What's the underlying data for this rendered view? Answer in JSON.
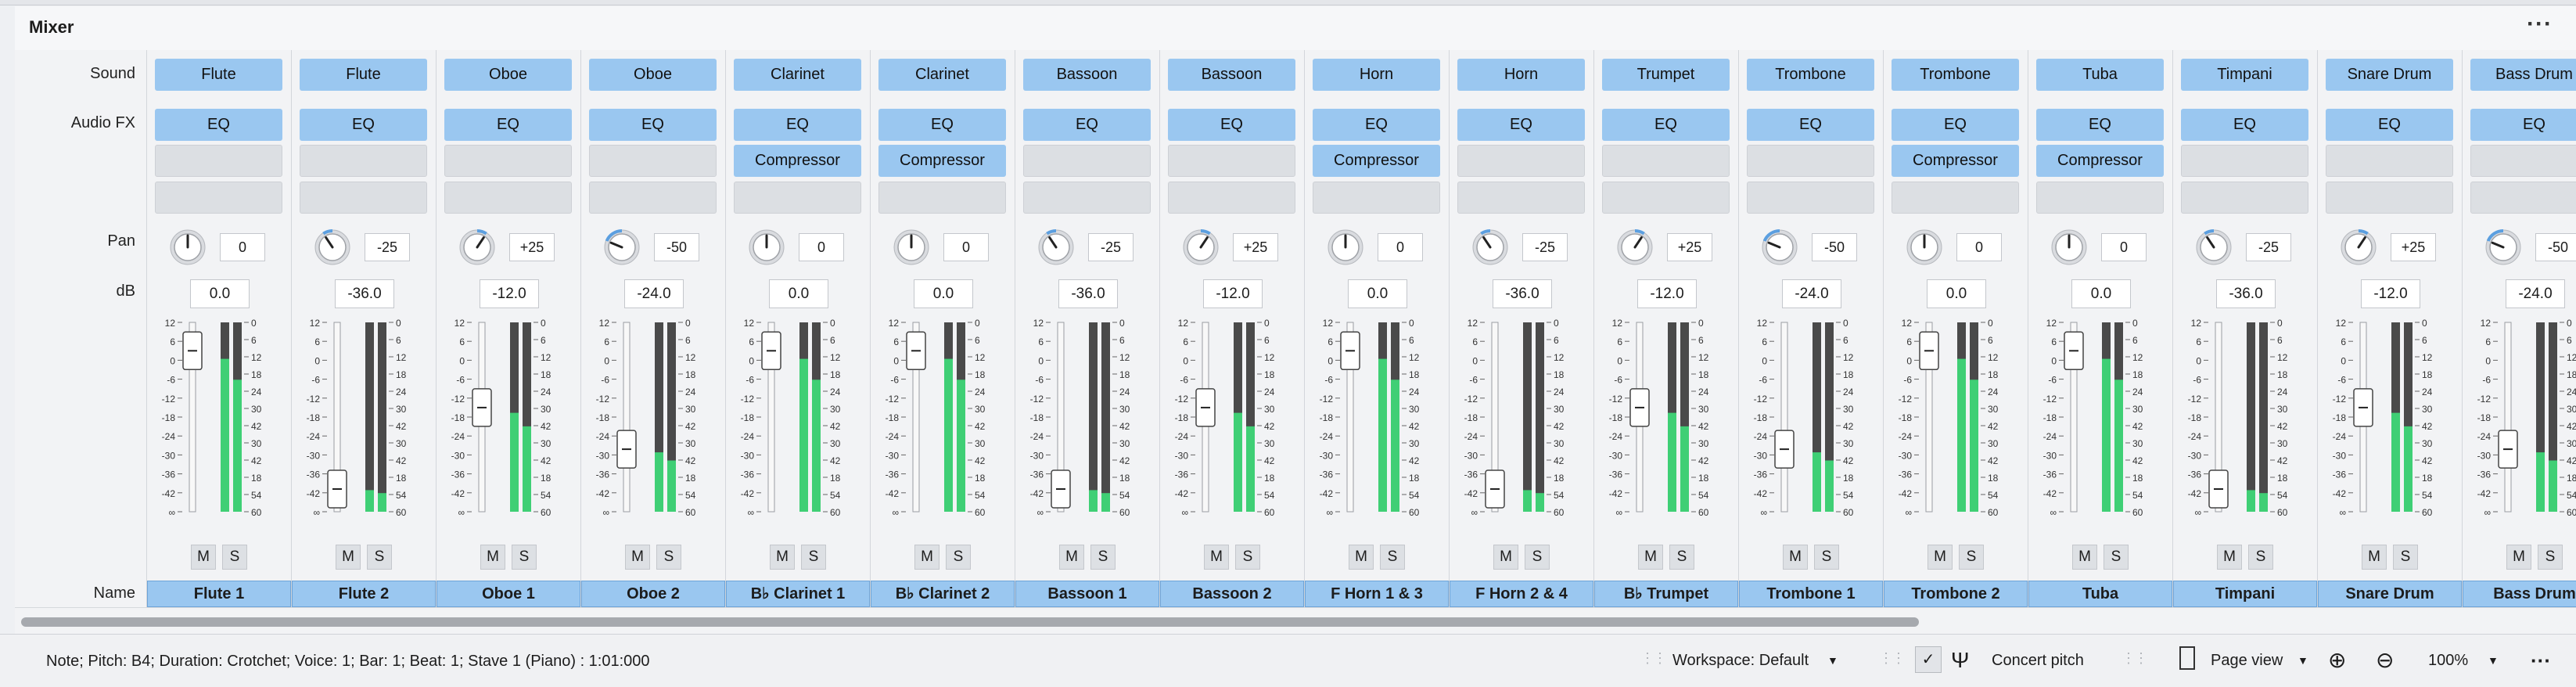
{
  "window_title": "Mixer",
  "menu_glyph": "···",
  "row_labels": {
    "sound": "Sound",
    "audio_fx": "Audio FX",
    "pan": "Pan",
    "db": "dB",
    "name": "Name"
  },
  "mute_label": "M",
  "solo_label": "S",
  "meter_scale_left": [
    "12",
    "6",
    "0",
    "-6",
    "-12",
    "-18",
    "-24",
    "-30",
    "-36",
    "-42",
    "∞"
  ],
  "meter_scale_right": [
    "0",
    "6",
    "12",
    "18",
    "24",
    "30",
    "42",
    "30",
    "42",
    "18",
    "54",
    "60"
  ],
  "channels": [
    {
      "sound": "Flute",
      "fx": [
        "EQ",
        ""
      ],
      "pan": "0",
      "pan_value": 0,
      "db": "0.0",
      "level": 0.85,
      "name": "Flute 1"
    },
    {
      "sound": "Flute",
      "fx": [
        "EQ",
        ""
      ],
      "pan": "-25",
      "pan_value": -25,
      "db": "-36.0",
      "level": 0.12,
      "name": "Flute 2"
    },
    {
      "sound": "Oboe",
      "fx": [
        "EQ",
        ""
      ],
      "pan": "+25",
      "pan_value": 25,
      "db": "-12.0",
      "level": 0.55,
      "name": "Oboe 1"
    },
    {
      "sound": "Oboe",
      "fx": [
        "EQ",
        ""
      ],
      "pan": "-50",
      "pan_value": -50,
      "db": "-24.0",
      "level": 0.33,
      "name": "Oboe 2"
    },
    {
      "sound": "Clarinet",
      "fx": [
        "EQ",
        "Compressor"
      ],
      "pan": "0",
      "pan_value": 0,
      "db": "0.0",
      "level": 0.85,
      "name": "B♭ Clarinet 1"
    },
    {
      "sound": "Clarinet",
      "fx": [
        "EQ",
        "Compressor"
      ],
      "pan": "0",
      "pan_value": 0,
      "db": "0.0",
      "level": 0.85,
      "name": "B♭ Clarinet 2"
    },
    {
      "sound": "Bassoon",
      "fx": [
        "EQ",
        ""
      ],
      "pan": "-25",
      "pan_value": -25,
      "db": "-36.0",
      "level": 0.12,
      "name": "Bassoon 1"
    },
    {
      "sound": "Bassoon",
      "fx": [
        "EQ",
        ""
      ],
      "pan": "+25",
      "pan_value": 25,
      "db": "-12.0",
      "level": 0.55,
      "name": "Bassoon 2"
    },
    {
      "sound": "Horn",
      "fx": [
        "EQ",
        "Compressor"
      ],
      "pan": "0",
      "pan_value": 0,
      "db": "0.0",
      "level": 0.85,
      "name": "F Horn 1 & 3"
    },
    {
      "sound": "Horn",
      "fx": [
        "EQ",
        ""
      ],
      "pan": "-25",
      "pan_value": -25,
      "db": "-36.0",
      "level": 0.12,
      "name": "F Horn 2 & 4"
    },
    {
      "sound": "Trumpet",
      "fx": [
        "EQ",
        ""
      ],
      "pan": "+25",
      "pan_value": 25,
      "db": "-12.0",
      "level": 0.55,
      "name": "B♭ Trumpet"
    },
    {
      "sound": "Trombone",
      "fx": [
        "EQ",
        ""
      ],
      "pan": "-50",
      "pan_value": -50,
      "db": "-24.0",
      "level": 0.33,
      "name": "Trombone 1"
    },
    {
      "sound": "Trombone",
      "fx": [
        "EQ",
        "Compressor"
      ],
      "pan": "0",
      "pan_value": 0,
      "db": "0.0",
      "level": 0.85,
      "name": "Trombone 2"
    },
    {
      "sound": "Tuba",
      "fx": [
        "EQ",
        "Compressor"
      ],
      "pan": "0",
      "pan_value": 0,
      "db": "0.0",
      "level": 0.85,
      "name": "Tuba"
    },
    {
      "sound": "Timpani",
      "fx": [
        "EQ",
        ""
      ],
      "pan": "-25",
      "pan_value": -25,
      "db": "-36.0",
      "level": 0.12,
      "name": "Timpani"
    },
    {
      "sound": "Snare Drum",
      "fx": [
        "EQ",
        ""
      ],
      "pan": "+25",
      "pan_value": 25,
      "db": "-12.0",
      "level": 0.55,
      "name": "Snare Drum"
    },
    {
      "sound": "Bass Drum",
      "fx": [
        "EQ",
        ""
      ],
      "pan": "-50",
      "pan_value": -50,
      "db": "-24.0",
      "level": 0.33,
      "name": "Bass Drum"
    }
  ],
  "status": {
    "text": "Note; Pitch: B4; Duration: Crotchet; Voice: 1; Bar: 1; Beat: 1; Stave 1 (Piano) :  1:01:000",
    "workspace": "Workspace: Default",
    "concert_pitch": "Concert pitch",
    "page_view": "Page view",
    "zoom": "100%",
    "more": "···"
  },
  "colors": {
    "button": "#9ac7f0",
    "meter_green": "#3fcf75",
    "meter_dark": "#4a4a4a",
    "knob_arc": "#5b9fe0"
  }
}
